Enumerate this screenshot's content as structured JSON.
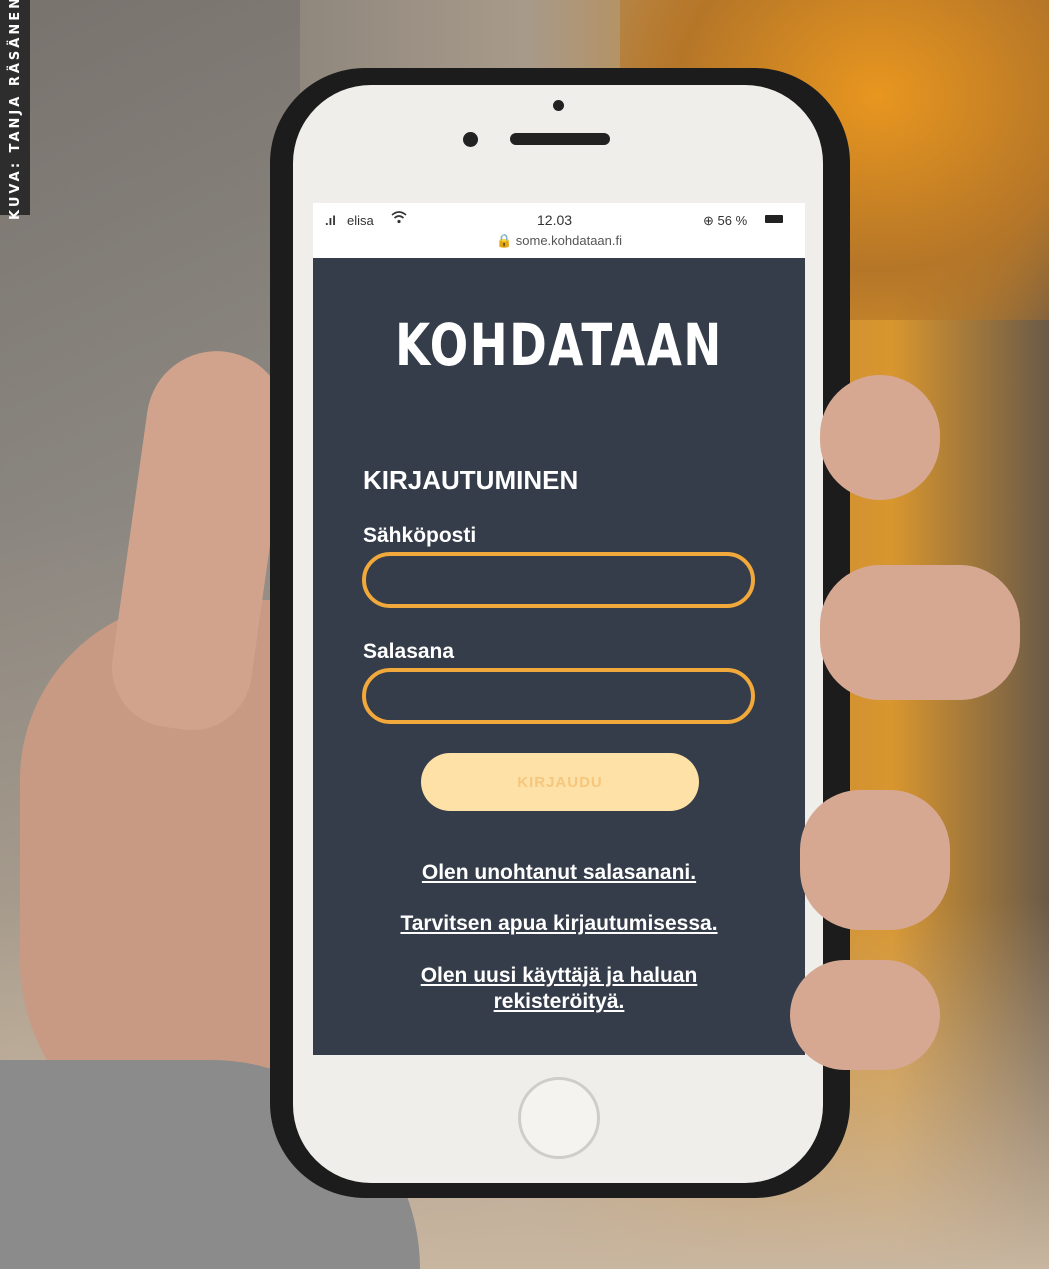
{
  "photo_credit": "KUVA: TANJA RÄSÄNEN",
  "status_bar": {
    "signal": ".ıl",
    "carrier": "elisa",
    "wifi": "wifi-icon",
    "time": "12.03",
    "battery_percent": "⊕ 56 %",
    "url": "🔒 some.kohdataan.fi"
  },
  "app": {
    "logo": "KOHDATAAN",
    "heading": "KIRJAUTUMINEN",
    "email_label": "Sähköposti",
    "email_value": "",
    "password_label": "Salasana",
    "password_value": "",
    "login_button": "KIRJAUDU",
    "links": [
      "Olen unohtanut salasanani.",
      "Tarvitsen apua kirjautumisessa.",
      "Olen uusi käyttäjä ja haluan rekisteröityä."
    ]
  },
  "colors": {
    "screen_bg": "#363d4a",
    "accent": "#f2a93b",
    "button_bg": "#fde1a6"
  }
}
